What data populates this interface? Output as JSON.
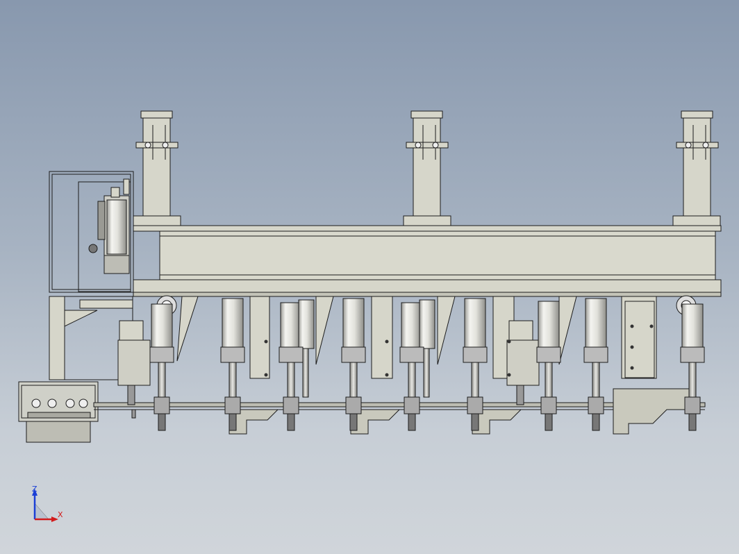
{
  "app": {
    "view": "cad-viewport",
    "background": "#a7b3c2"
  },
  "colors": {
    "metal_fill": "#d9d9cd",
    "metal_dark": "#bfbfb2",
    "edge": "#1c1c1c",
    "cylinder_light": "#f2f2ee",
    "cylinder_shade": "#a7a7a2",
    "axis_z": "#1b3fd6",
    "axis_x": "#d21c1c"
  },
  "triad": {
    "z_label": "Z",
    "x_label": "X",
    "icon": "coordinate-triad-icon"
  }
}
